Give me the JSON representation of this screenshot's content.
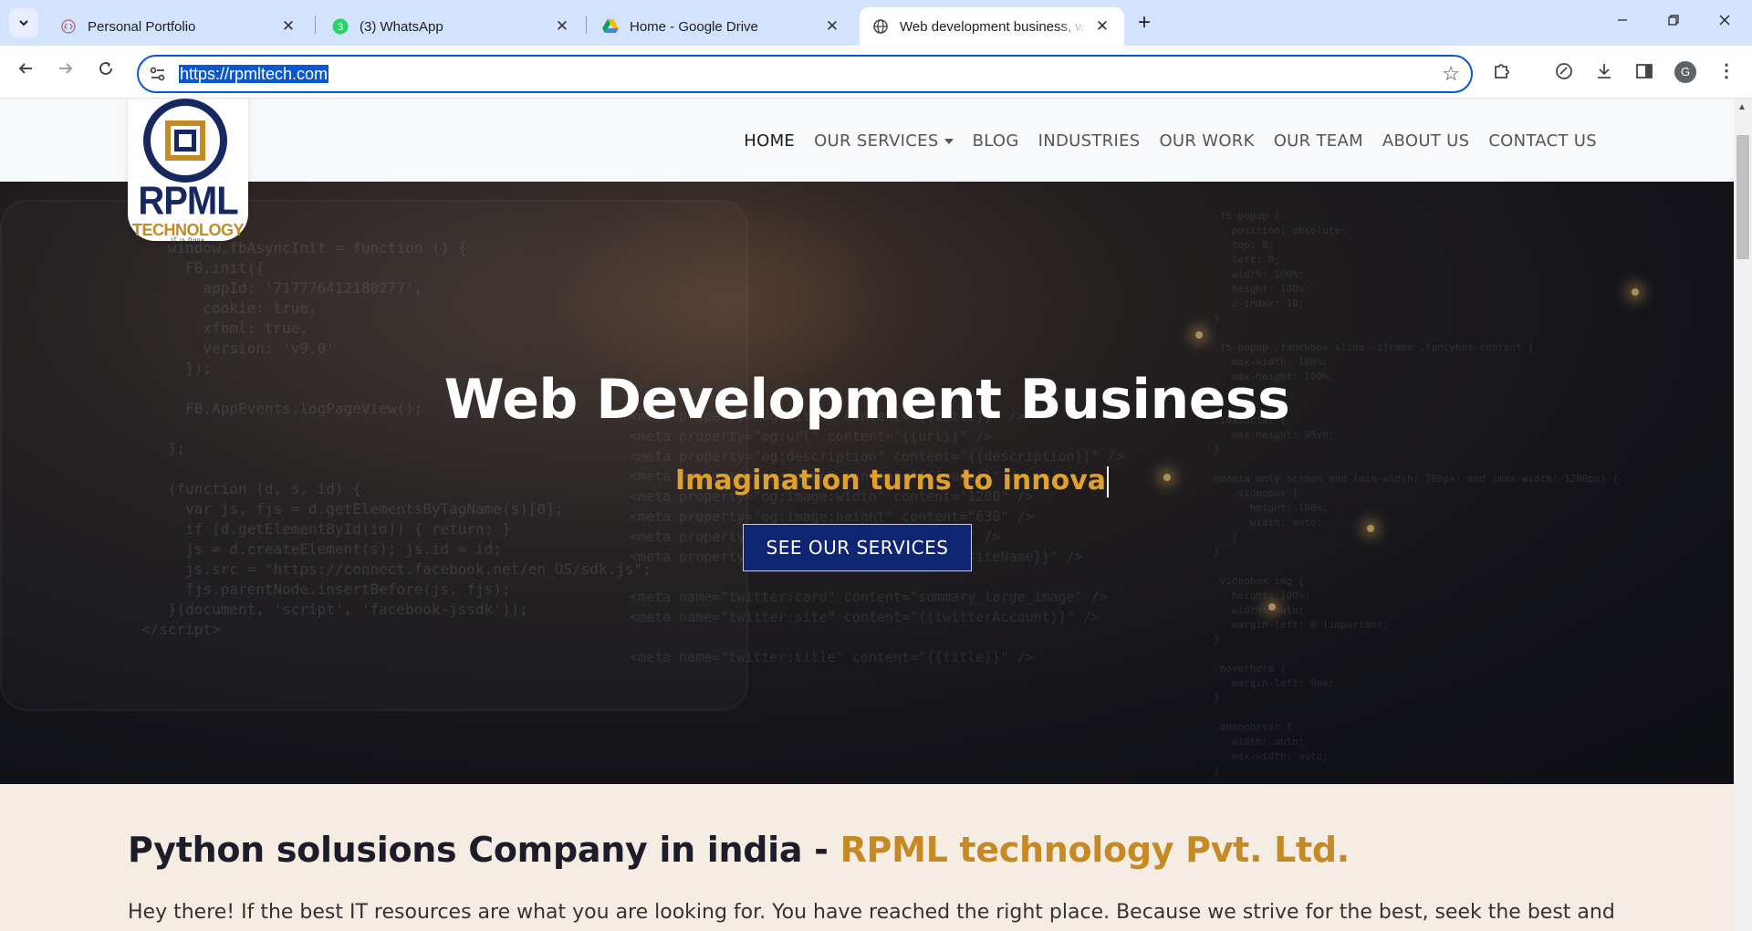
{
  "browser": {
    "tabs": [
      {
        "title": "Personal Portfolio",
        "favicon": "code-icon"
      },
      {
        "title": "(3) WhatsApp",
        "favicon": "whatsapp-icon",
        "badge": "3"
      },
      {
        "title": "Home - Google Drive",
        "favicon": "google-drive-icon"
      },
      {
        "title": "Web development business, we",
        "favicon": "globe-icon",
        "active": true
      }
    ],
    "url": "https://rpmltech.com",
    "profile_initial": "G"
  },
  "site": {
    "logo": {
      "word": "RPML",
      "sub": "TECHNOLOGY",
      "tagline": "IT is Done"
    },
    "nav": {
      "home": "HOME",
      "services": "OUR SERVICES",
      "blog": "BLOG",
      "industries": "INDUSTRIES",
      "work": "OUR WORK",
      "team": "OUR TEAM",
      "about": "ABOUT US",
      "contact": "CONTACT US"
    },
    "hero": {
      "title": "Web Development Business",
      "subtitle": "Imagination turns to innova",
      "cta": "SEE OUR SERVICES"
    },
    "intro": {
      "heading_prefix": "Python solusions Company in india - ",
      "heading_accent": "RPML technology Pvt. Ltd.",
      "paragraph": "Hey there! If the best IT resources are what you are looking for. You have reached the right place. Because we strive for the best, seek the best and"
    }
  },
  "colors": {
    "brand_navy": "#102571",
    "brand_gold": "#c58a23",
    "omnibox_focus": "#0b57d0"
  }
}
